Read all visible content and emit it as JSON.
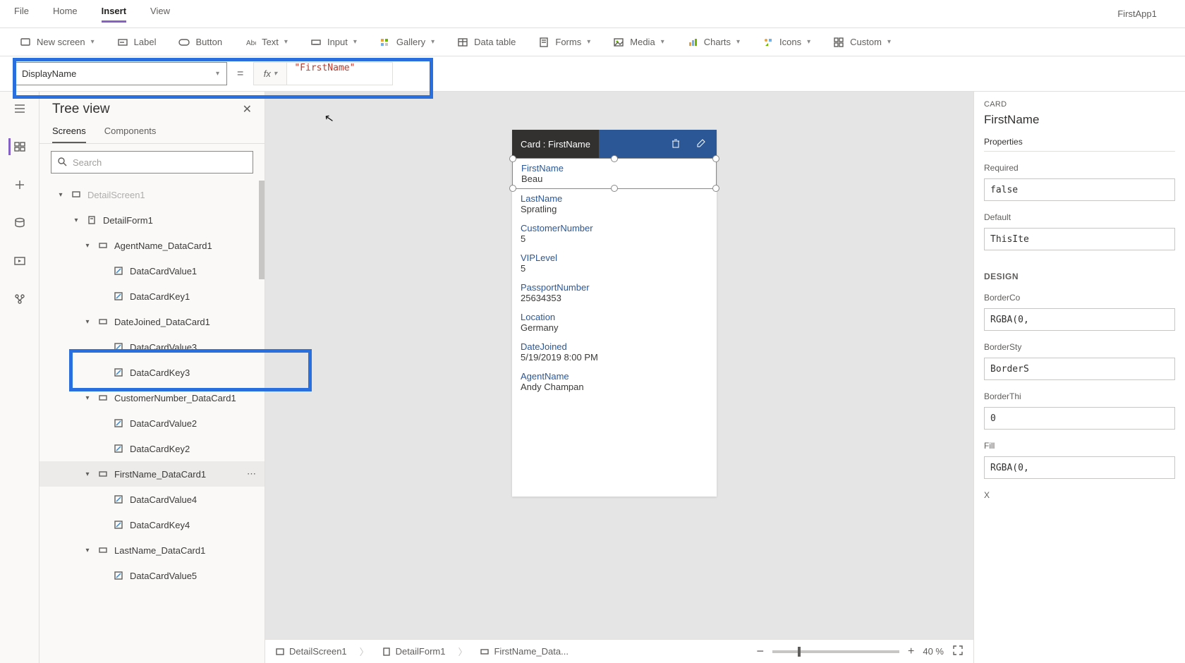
{
  "app_title": "FirstApp1",
  "menubar": {
    "tabs": [
      "File",
      "Home",
      "Insert",
      "View"
    ],
    "active_index": 2
  },
  "ribbon": [
    {
      "label": "New screen",
      "icon": "screen",
      "chev": true
    },
    {
      "label": "Label",
      "icon": "label",
      "chev": false
    },
    {
      "label": "Button",
      "icon": "button",
      "chev": false
    },
    {
      "label": "Text",
      "icon": "text",
      "chev": true
    },
    {
      "label": "Input",
      "icon": "input",
      "chev": true
    },
    {
      "label": "Gallery",
      "icon": "gallery",
      "chev": true
    },
    {
      "label": "Data table",
      "icon": "datatable",
      "chev": false
    },
    {
      "label": "Forms",
      "icon": "forms",
      "chev": true
    },
    {
      "label": "Media",
      "icon": "media",
      "chev": true
    },
    {
      "label": "Charts",
      "icon": "charts",
      "chev": true
    },
    {
      "label": "Icons",
      "icon": "icons",
      "chev": true
    },
    {
      "label": "Custom",
      "icon": "custom",
      "chev": true
    }
  ],
  "formula": {
    "property": "DisplayName",
    "value": "\"FirstName\""
  },
  "treeview": {
    "title": "Tree view",
    "tabs": [
      "Screens",
      "Components"
    ],
    "active_tab": 0,
    "search_placeholder": "Search",
    "items": [
      {
        "indent": 1,
        "icon": "screen",
        "label": "DetailScreen1",
        "chev": "down",
        "dim": true
      },
      {
        "indent": 2,
        "icon": "form",
        "label": "DetailForm1",
        "chev": "down"
      },
      {
        "indent": 3,
        "icon": "card",
        "label": "AgentName_DataCard1",
        "chev": "down"
      },
      {
        "indent": 4,
        "icon": "ctrl",
        "label": "DataCardValue1"
      },
      {
        "indent": 4,
        "icon": "ctrl",
        "label": "DataCardKey1"
      },
      {
        "indent": 3,
        "icon": "card",
        "label": "DateJoined_DataCard1",
        "chev": "down"
      },
      {
        "indent": 4,
        "icon": "ctrl",
        "label": "DataCardValue3"
      },
      {
        "indent": 4,
        "icon": "ctrl",
        "label": "DataCardKey3"
      },
      {
        "indent": 3,
        "icon": "card",
        "label": "CustomerNumber_DataCard1",
        "chev": "down"
      },
      {
        "indent": 4,
        "icon": "ctrl",
        "label": "DataCardValue2"
      },
      {
        "indent": 4,
        "icon": "ctrl",
        "label": "DataCardKey2"
      },
      {
        "indent": 3,
        "icon": "card",
        "label": "FirstName_DataCard1",
        "chev": "down",
        "selected": true,
        "dots": true
      },
      {
        "indent": 4,
        "icon": "ctrl",
        "label": "DataCardValue4"
      },
      {
        "indent": 4,
        "icon": "ctrl",
        "label": "DataCardKey4"
      },
      {
        "indent": 3,
        "icon": "card",
        "label": "LastName_DataCard1",
        "chev": "down"
      },
      {
        "indent": 4,
        "icon": "ctrl",
        "label": "DataCardValue5"
      }
    ]
  },
  "canvas": {
    "card_header": "Card : FirstName",
    "fields": [
      {
        "label": "FirstName",
        "value": "Beau",
        "selected": true
      },
      {
        "label": "LastName",
        "value": "Spratling"
      },
      {
        "label": "CustomerNumber",
        "value": "5"
      },
      {
        "label": "VIPLevel",
        "value": "5"
      },
      {
        "label": "PassportNumber",
        "value": "25634353"
      },
      {
        "label": "Location",
        "value": "Germany"
      },
      {
        "label": "DateJoined",
        "value": "5/19/2019 8:00 PM"
      },
      {
        "label": "AgentName",
        "value": "Andy Champan"
      }
    ]
  },
  "breadcrumb": [
    "DetailScreen1",
    "DetailForm1",
    "FirstName_Data..."
  ],
  "zoom_pct": "40 %",
  "props": {
    "kind": "CARD",
    "name": "FirstName",
    "tab": "Properties",
    "required_label": "Required",
    "required_value": "false",
    "default_label": "Default",
    "default_value": "ThisIte",
    "design_label": "DESIGN",
    "bordercolor_label": "BorderCo",
    "bordercolor_value": "RGBA(0,",
    "borderstyle_label": "BorderSty",
    "borderstyle_value": "BorderS",
    "borderthick_label": "BorderThi",
    "borderthick_value": "0",
    "fill_label": "Fill",
    "fill_value": "RGBA(0,",
    "x_label": "X"
  }
}
